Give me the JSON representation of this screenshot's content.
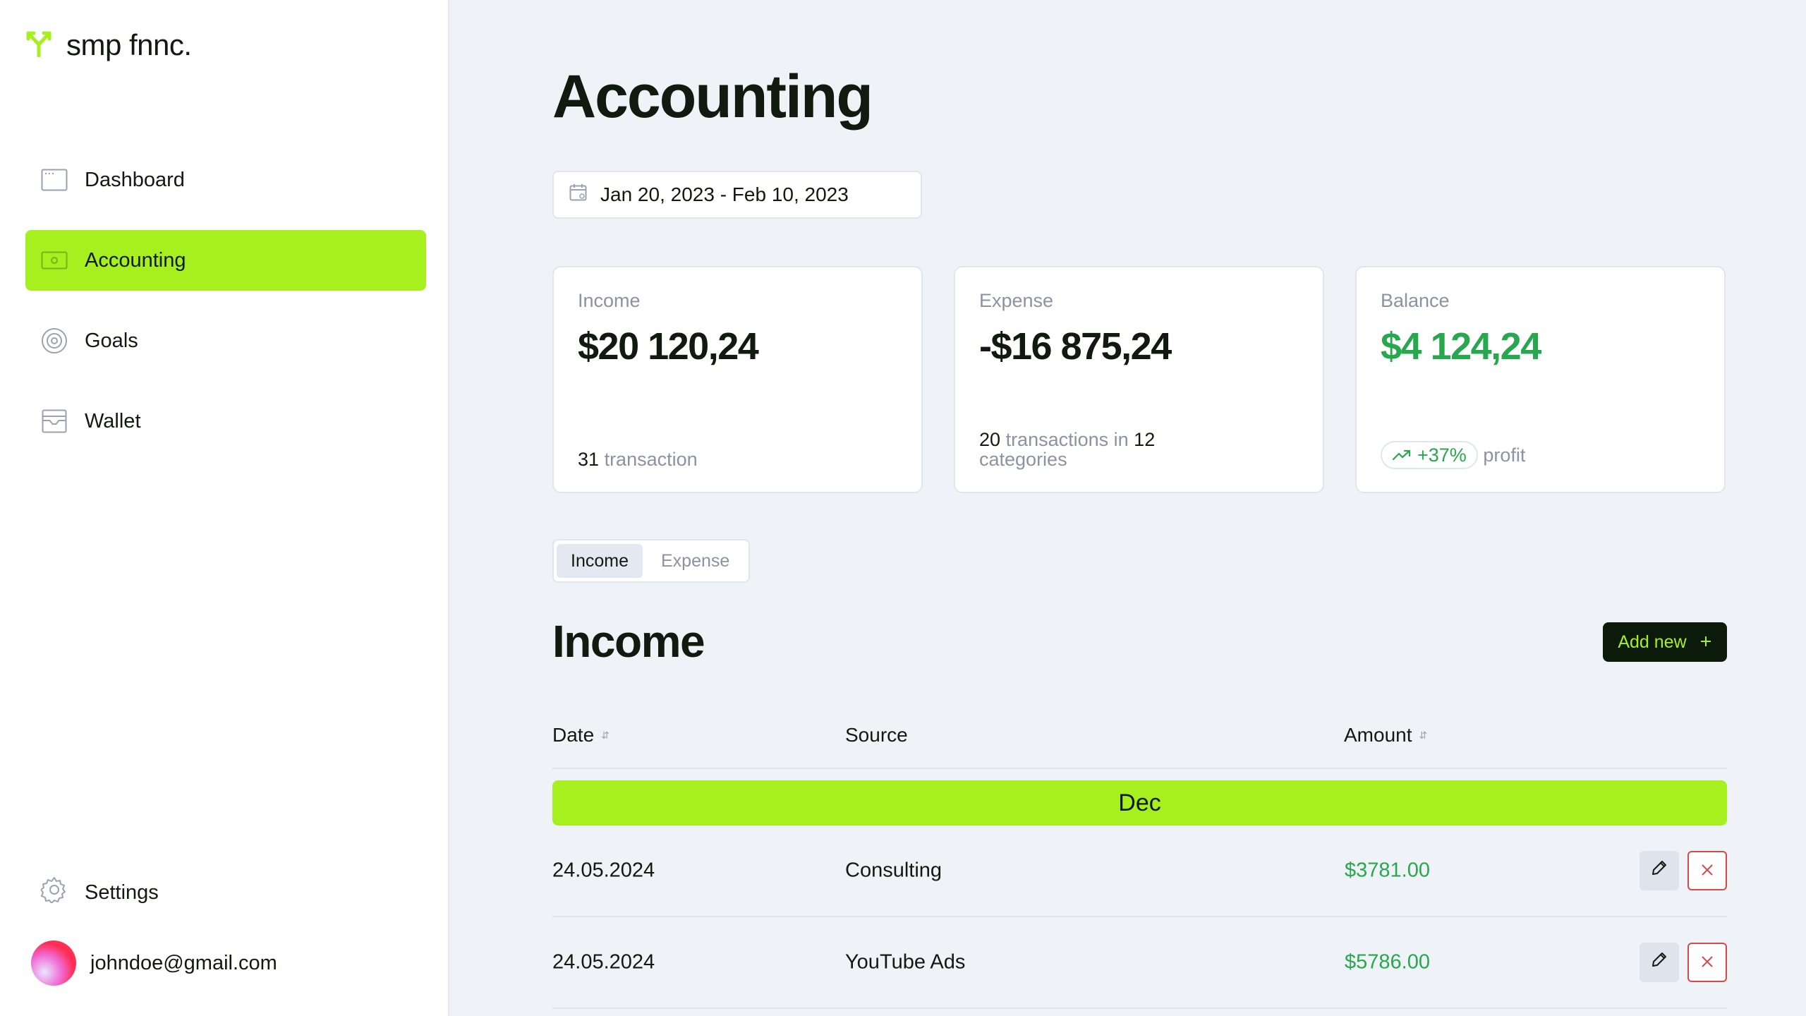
{
  "brand": {
    "name": "smp fnnc.",
    "accent": "#a7f01f"
  },
  "sidebar": {
    "items": [
      {
        "label": "Dashboard",
        "icon": "dashboard-icon"
      },
      {
        "label": "Accounting",
        "icon": "banknote-icon",
        "active": true
      },
      {
        "label": "Goals",
        "icon": "target-icon"
      },
      {
        "label": "Wallet",
        "icon": "wallet-icon"
      }
    ],
    "settings_label": "Settings",
    "user_email": "johndoe@gmail.com"
  },
  "page": {
    "title": "Accounting",
    "date_range": "Jan 20, 2023 - Feb 10, 2023"
  },
  "cards": {
    "income": {
      "label": "Income",
      "value": "$20 120,24",
      "count": "31",
      "count_text": "transaction"
    },
    "expense": {
      "label": "Expense",
      "value": "-$16 875,24",
      "count": "20",
      "mid_text": "transactions in",
      "categories": "12",
      "categories_text": "categories"
    },
    "balance": {
      "label": "Balance",
      "value": "$4 124,24",
      "change": "+37%",
      "change_text": "profit"
    }
  },
  "tabs": {
    "income": "Income",
    "expense": "Expense",
    "selected": "Income"
  },
  "section": {
    "title": "Income",
    "add_label": "Add new"
  },
  "table": {
    "columns": {
      "date": "Date",
      "source": "Source",
      "amount": "Amount"
    },
    "group": "Dec",
    "rows": [
      {
        "date": "24.05.2024",
        "source": "Consulting",
        "amount": "$3781.00"
      },
      {
        "date": "24.05.2024",
        "source": "YouTube Ads",
        "amount": "$5786.00"
      }
    ]
  },
  "colors": {
    "positive": "#27a84e",
    "danger": "#d94848",
    "dark_button": "#0c1a0a"
  }
}
